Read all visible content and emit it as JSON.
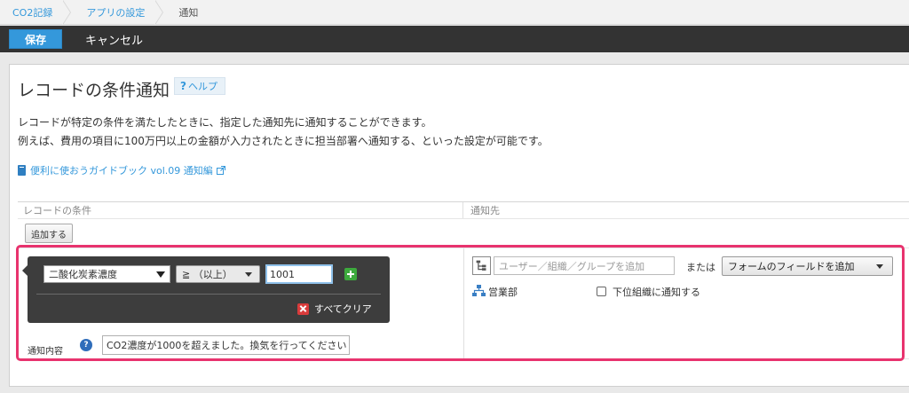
{
  "breadcrumb": {
    "items": [
      {
        "label": "CO2記録"
      },
      {
        "label": "アプリの設定"
      },
      {
        "label": "通知"
      }
    ]
  },
  "toolbar": {
    "save_label": "保存",
    "cancel_label": "キャンセル"
  },
  "page": {
    "title": "レコードの条件通知",
    "help_label": "ヘルプ",
    "help_mark": "?",
    "description_1": "レコードが特定の条件を満たしたときに、指定した通知先に通知することができます。",
    "description_2": "例えば、費用の項目に100万円以上の金額が入力されたときに担当部署へ通知する、といった設定が可能です。",
    "guide_link": "便利に使おうガイドブック vol.09 通知編"
  },
  "table": {
    "col_condition": "レコードの条件",
    "col_notify": "通知先",
    "add_label": "追加する"
  },
  "condition": {
    "field": "二酸化炭素濃度",
    "operator": "≧ （以上）",
    "value": "1001",
    "clear_all_label": "すべてクリア"
  },
  "message": {
    "label": "通知内容",
    "help_mark": "?",
    "value": "CO2濃度が1000を超えました。換気を行ってください"
  },
  "notify": {
    "user_placeholder": "ユーザー／組織／グループを追加",
    "or_label": "または",
    "form_field_label": "フォームのフィールドを追加",
    "department": "営業部",
    "include_sub_label": "下位組織に通知する"
  },
  "colors": {
    "accent": "#3498db",
    "toolbar_bg": "#333333",
    "highlight": "#e8336e"
  }
}
